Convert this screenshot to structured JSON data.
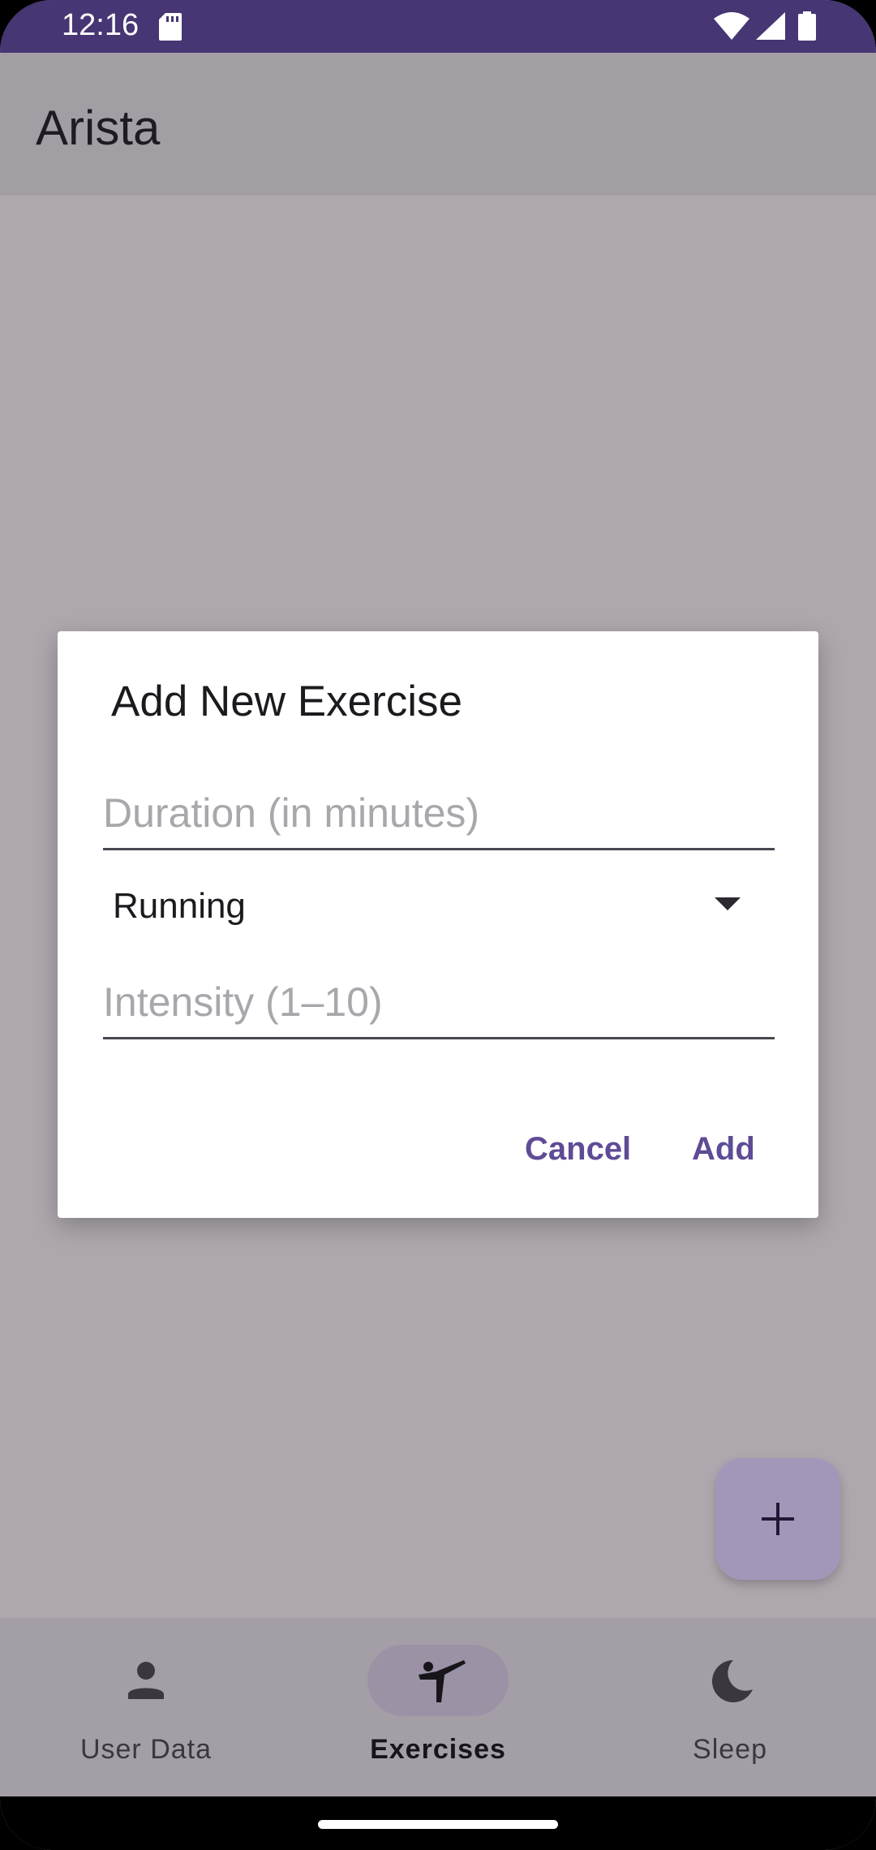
{
  "status_bar": {
    "time": "12:16"
  },
  "app_bar": {
    "title": "Arista"
  },
  "dialog": {
    "title": "Add New Exercise",
    "duration_placeholder": "Duration (in minutes)",
    "duration_value": "",
    "exercise_type": "Running",
    "intensity_placeholder": "Intensity (1–10)",
    "intensity_value": "",
    "cancel_label": "Cancel",
    "add_label": "Add"
  },
  "fab": {
    "icon": "plus-icon"
  },
  "bottom_nav": {
    "items": [
      {
        "label": "User Data",
        "icon": "person-icon",
        "selected": false
      },
      {
        "label": "Exercises",
        "icon": "exercise-icon",
        "selected": true
      },
      {
        "label": "Sleep",
        "icon": "moon-icon",
        "selected": false
      }
    ]
  },
  "colors": {
    "status_bar": "#463673",
    "accent": "#5f4b96",
    "fab": "#a397b9"
  }
}
